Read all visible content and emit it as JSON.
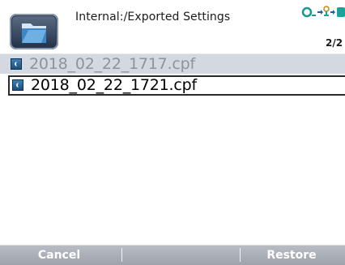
{
  "header": {
    "path": "Internal:/Exported Settings",
    "page_indicator": "2/2"
  },
  "files": [
    {
      "name": "2018_02_22_1717.cpf",
      "selected": false
    },
    {
      "name": "2018_02_22_1721.cpf",
      "selected": true
    }
  ],
  "softkeys": {
    "left": "Cancel",
    "middle": "",
    "right": "Restore"
  },
  "icons": {
    "folder": "folder-icon",
    "file": "settings-file-icon",
    "status": "connection-status-icon",
    "battery": "battery-icon"
  },
  "colors": {
    "selected_text": "#000000",
    "unselected_text": "#8e939c",
    "softkey_bar": "#a9adb5",
    "folder_button": "#2a3a52",
    "status_accent": "#1aa39a"
  }
}
